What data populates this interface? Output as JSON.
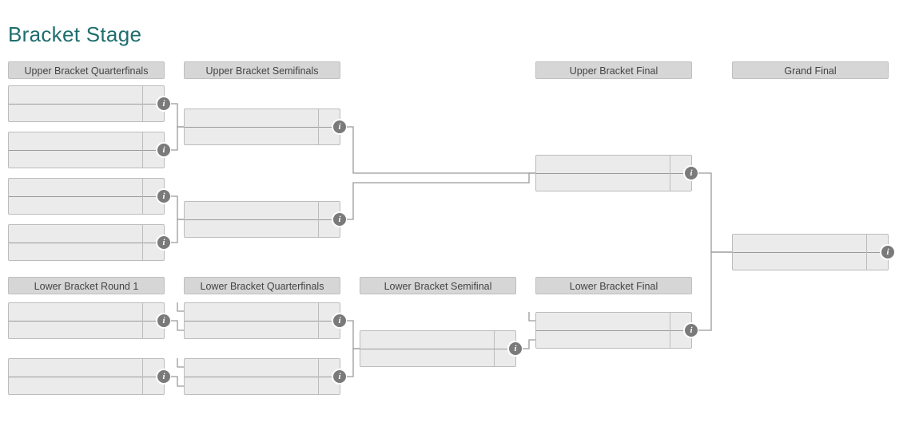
{
  "title": "Bracket Stage",
  "rounds": {
    "upper_qf": "Upper Bracket Quarterfinals",
    "upper_sf": "Upper Bracket Semifinals",
    "upper_f": "Upper Bracket Final",
    "grand_f": "Grand Final",
    "lower_r1": "Lower Bracket Round 1",
    "lower_qf": "Lower Bracket Quarterfinals",
    "lower_sf": "Lower Bracket Semifinal",
    "lower_f": "Lower Bracket Final"
  },
  "matches": {
    "uqf1": {
      "team1": "",
      "team2": "",
      "score1": "",
      "score2": ""
    },
    "uqf2": {
      "team1": "",
      "team2": "",
      "score1": "",
      "score2": ""
    },
    "uqf3": {
      "team1": "",
      "team2": "",
      "score1": "",
      "score2": ""
    },
    "uqf4": {
      "team1": "",
      "team2": "",
      "score1": "",
      "score2": ""
    },
    "usf1": {
      "team1": "",
      "team2": "",
      "score1": "",
      "score2": ""
    },
    "usf2": {
      "team1": "",
      "team2": "",
      "score1": "",
      "score2": ""
    },
    "uf": {
      "team1": "",
      "team2": "",
      "score1": "",
      "score2": ""
    },
    "lr1a": {
      "team1": "",
      "team2": "",
      "score1": "",
      "score2": ""
    },
    "lr1b": {
      "team1": "",
      "team2": "",
      "score1": "",
      "score2": ""
    },
    "lqf1": {
      "team1": "",
      "team2": "",
      "score1": "",
      "score2": ""
    },
    "lqf2": {
      "team1": "",
      "team2": "",
      "score1": "",
      "score2": ""
    },
    "lsf": {
      "team1": "",
      "team2": "",
      "score1": "",
      "score2": ""
    },
    "lf": {
      "team1": "",
      "team2": "",
      "score1": "",
      "score2": ""
    },
    "gf": {
      "team1": "",
      "team2": "",
      "score1": "",
      "score2": ""
    }
  }
}
